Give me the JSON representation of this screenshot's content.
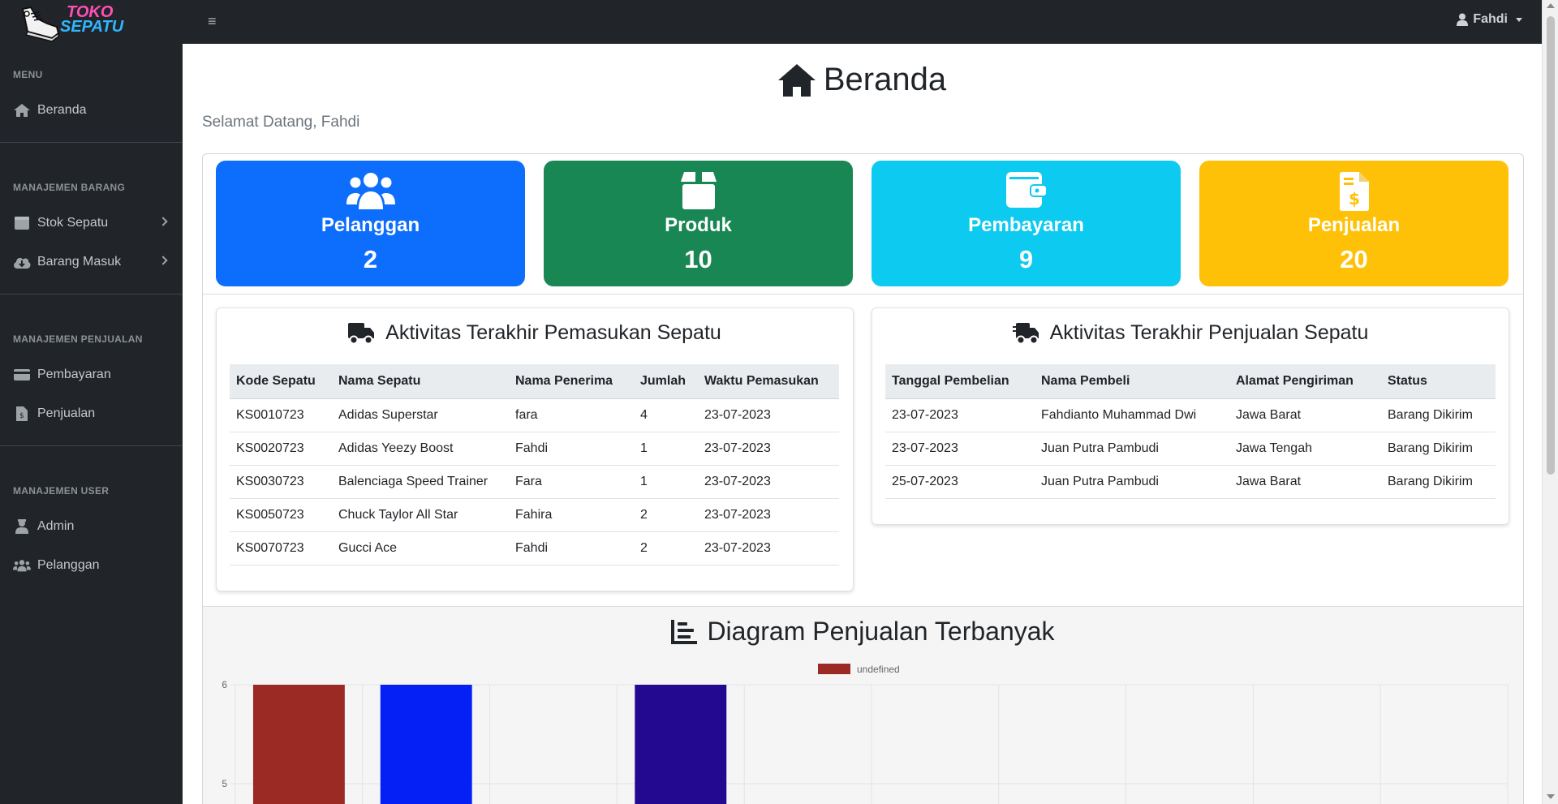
{
  "brand": {
    "line1": "TOKO",
    "line2": "SEPATU",
    "logo_icon": "sneaker-icon"
  },
  "topbar": {
    "menu_icon": "hamburger-icon",
    "user_name": "Fahdi",
    "user_icon": "user-icon"
  },
  "sidebar": {
    "sections": [
      {
        "heading": "MENU",
        "items": [
          {
            "label": "Beranda",
            "icon": "home-icon"
          }
        ]
      },
      {
        "heading": "MANAJEMEN BARANG",
        "items": [
          {
            "label": "Stok Sepatu",
            "icon": "boxes-icon"
          },
          {
            "label": "Barang Masuk",
            "icon": "cloud-download-icon"
          }
        ]
      },
      {
        "heading": "MANAJEMEN PENJUALAN",
        "items": [
          {
            "label": "Pembayaran",
            "icon": "credit-card-icon"
          },
          {
            "label": "Penjualan",
            "icon": "invoice-icon"
          }
        ]
      },
      {
        "heading": "MANAJEMEN USER",
        "items": [
          {
            "label": "Admin",
            "icon": "admin-icon"
          },
          {
            "label": "Pelanggan",
            "icon": "users-icon"
          }
        ]
      }
    ]
  },
  "page": {
    "title": "Beranda",
    "welcome": "Selamat Datang, Fahdi"
  },
  "stats": [
    {
      "label": "Pelanggan",
      "value": "2",
      "icon": "users-icon",
      "color": "#0d6efd"
    },
    {
      "label": "Produk",
      "value": "10",
      "icon": "box-icon",
      "color": "#198754"
    },
    {
      "label": "Pembayaran",
      "value": "9",
      "icon": "wallet-icon",
      "color": "#0dcaf0"
    },
    {
      "label": "Penjualan",
      "value": "20",
      "icon": "invoice-dollar-icon",
      "color": "#ffc107"
    }
  ],
  "incoming": {
    "title": "Aktivitas Terakhir Pemasukan Sepatu",
    "headers": [
      "Kode Sepatu",
      "Nama Sepatu",
      "Nama Penerima",
      "Jumlah",
      "Waktu Pemasukan"
    ],
    "rows": [
      [
        "KS0010723",
        "Adidas Superstar",
        "fara",
        "4",
        "23-07-2023"
      ],
      [
        "KS0020723",
        "Adidas Yeezy Boost",
        "Fahdi",
        "1",
        "23-07-2023"
      ],
      [
        "KS0030723",
        "Balenciaga Speed Trainer",
        "Fara",
        "1",
        "23-07-2023"
      ],
      [
        "KS0050723",
        "Chuck Taylor All Star",
        "Fahira",
        "2",
        "23-07-2023"
      ],
      [
        "KS0070723",
        "Gucci Ace",
        "Fahdi",
        "2",
        "23-07-2023"
      ]
    ]
  },
  "sales": {
    "title": "Aktivitas Terakhir Penjualan Sepatu",
    "headers": [
      "Tanggal Pembelian",
      "Nama Pembeli",
      "Alamat Pengiriman",
      "Status"
    ],
    "rows": [
      [
        "23-07-2023",
        "Fahdianto Muhammad Dwi",
        "Jawa Barat",
        "Barang Dikirim"
      ],
      [
        "23-07-2023",
        "Juan Putra Pambudi",
        "Jawa Tengah",
        "Barang Dikirim"
      ],
      [
        "25-07-2023",
        "Juan Putra Pambudi",
        "Jawa Barat",
        "Barang Dikirim"
      ]
    ]
  },
  "chart_title": "Diagram Penjualan Terbanyak",
  "chart_data": {
    "type": "bar",
    "title": "Diagram Penjualan Terbanyak",
    "legend": [
      "undefined"
    ],
    "legend_color": "#9b2a25",
    "y_ticks_visible": [
      "6",
      "5"
    ],
    "ylim_visible": [
      5,
      6
    ],
    "slot_count": 10,
    "values": [
      6,
      6,
      null,
      6,
      null,
      null,
      null,
      null,
      null,
      null
    ],
    "colors": [
      "#9b2a25",
      "#0420f5",
      null,
      "#230890",
      null,
      null,
      null,
      null,
      null,
      null
    ],
    "grid": true
  }
}
